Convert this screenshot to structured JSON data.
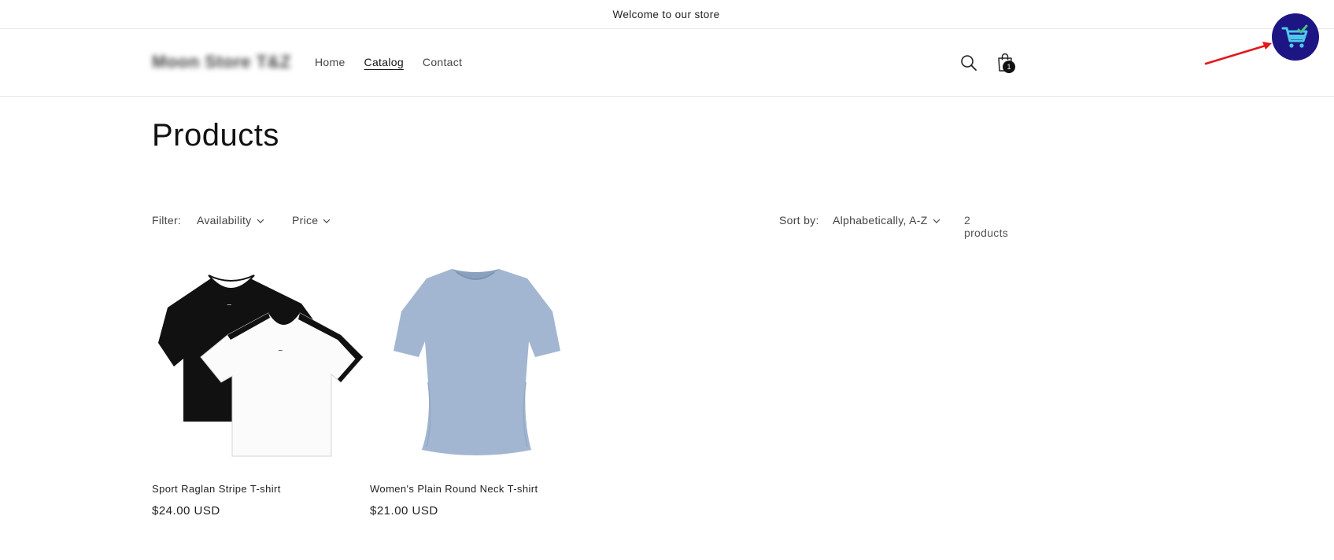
{
  "announcement": {
    "text": "Welcome to our store"
  },
  "header": {
    "logo": "Moon Store T&Z",
    "nav": [
      {
        "label": "Home",
        "active": false
      },
      {
        "label": "Catalog",
        "active": true
      },
      {
        "label": "Contact",
        "active": false
      }
    ],
    "cart_count": "1",
    "icons": [
      "search-icon",
      "shopping-bag-icon"
    ]
  },
  "floating_widget": {
    "icon": "cart-check-icon",
    "background": "#1e1585",
    "accent": "#4ec9e8",
    "check": "#46c08a"
  },
  "annotation": {
    "arrow_color": "#e3171a"
  },
  "page": {
    "title": "Products"
  },
  "facets": {
    "filter_label": "Filter:",
    "filters": [
      "Availability",
      "Price"
    ],
    "sort_label": "Sort by:",
    "sort_value": "Alphabetically, A-Z",
    "product_count": "2 products"
  },
  "products": [
    {
      "name": "Sport Raglan Stripe T-shirt",
      "price": "$24.00 USD"
    },
    {
      "name": "Women's Plain Round Neck T-shirt",
      "price": "$21.00 USD"
    }
  ]
}
